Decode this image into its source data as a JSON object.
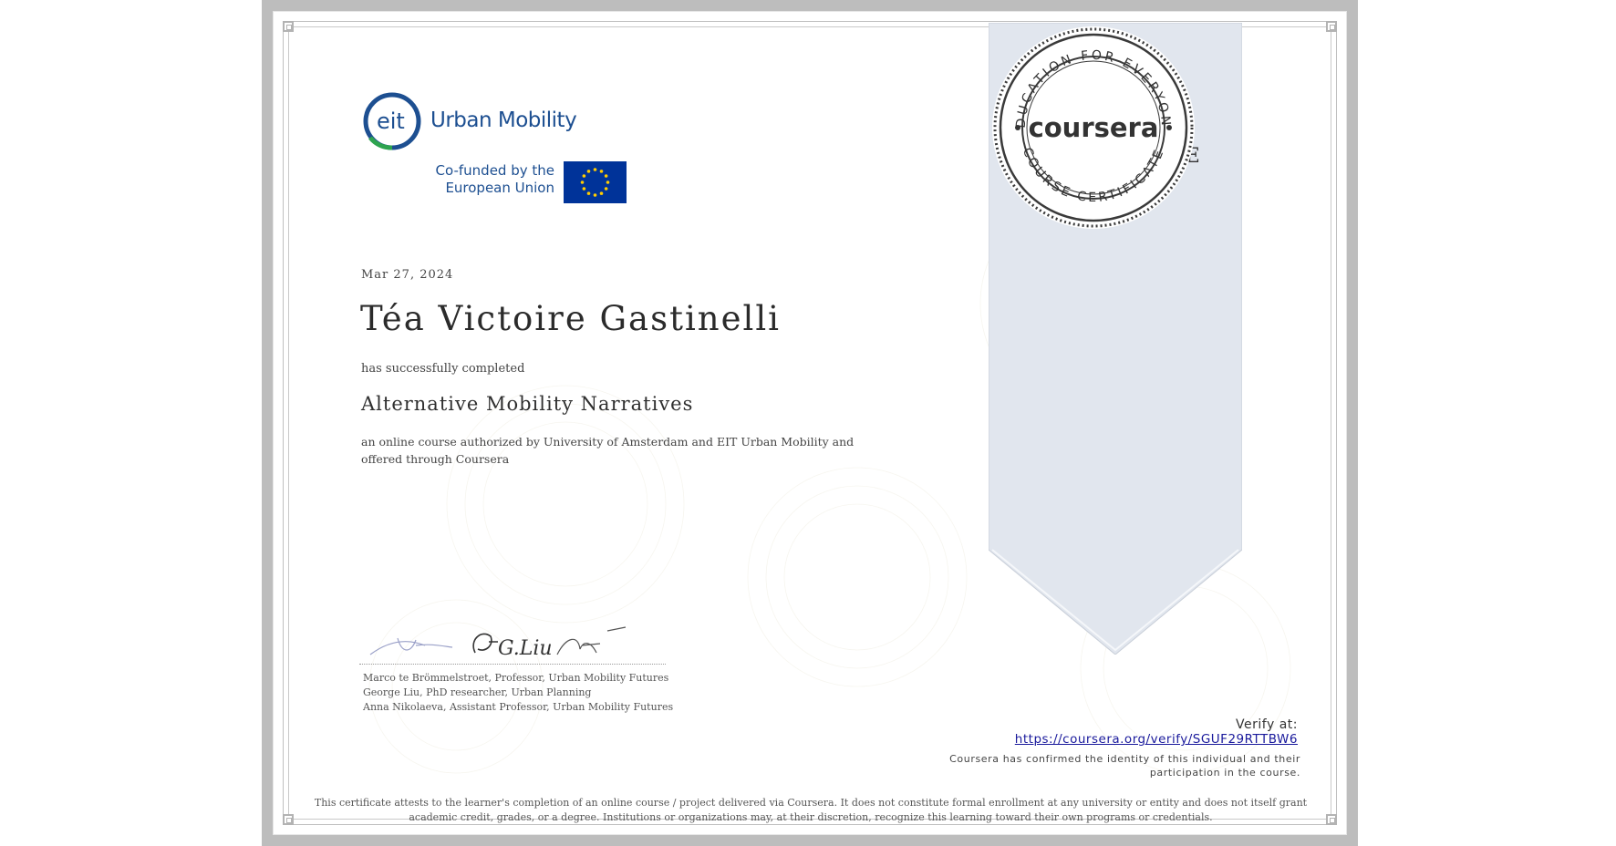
{
  "ribbon": {
    "title_line1": "COURSE",
    "title_line2": "CERTIFICATE"
  },
  "seal": {
    "brand": "coursera",
    "ring_top": "EDUCATION FOR EVERYONE",
    "ring_bottom": "COURSE CERTIFICATE"
  },
  "logos": {
    "eit_badge": "eit",
    "eit_name": "Urban Mobility",
    "cofund_line1": "Co-funded by the",
    "cofund_line2": "European Union"
  },
  "certificate": {
    "date": "Mar 27, 2024",
    "learner_name": "Téa Victoire Gastinelli",
    "completed_text": "has successfully completed",
    "course_name": "Alternative Mobility Narratives",
    "description": "an online course authorized by University of Amsterdam and EIT Urban Mobility and offered through Coursera"
  },
  "signatures": {
    "signers": [
      "Marco te Brömmelstroet, Professor, Urban Mobility Futures",
      "George Liu, PhD researcher, Urban Planning",
      "Anna Nikolaeva, Assistant Professor, Urban Mobility Futures"
    ],
    "handwriting": "G.Liu"
  },
  "verify": {
    "label": "Verify at:",
    "url": "https://coursera.org/verify/SGUF29RTTBW6",
    "note": "Coursera has confirmed the identity of this individual and their participation in the course."
  },
  "disclaimer": "This certificate attests to the learner's completion of an online course / project delivered via Coursera. It does not constitute formal enrollment at any university or entity and does not itself grant academic credit, grades, or a degree. Institutions or organizations may, at their discretion, recognize this learning toward their own programs or credentials.",
  "colors": {
    "eit_blue": "#1d4f91",
    "eit_green": "#2ea44f",
    "ribbon_fill": "#e1e6ee",
    "eu_blue": "#003399",
    "eu_star": "#ffcc00",
    "link": "#1a1a9c"
  }
}
